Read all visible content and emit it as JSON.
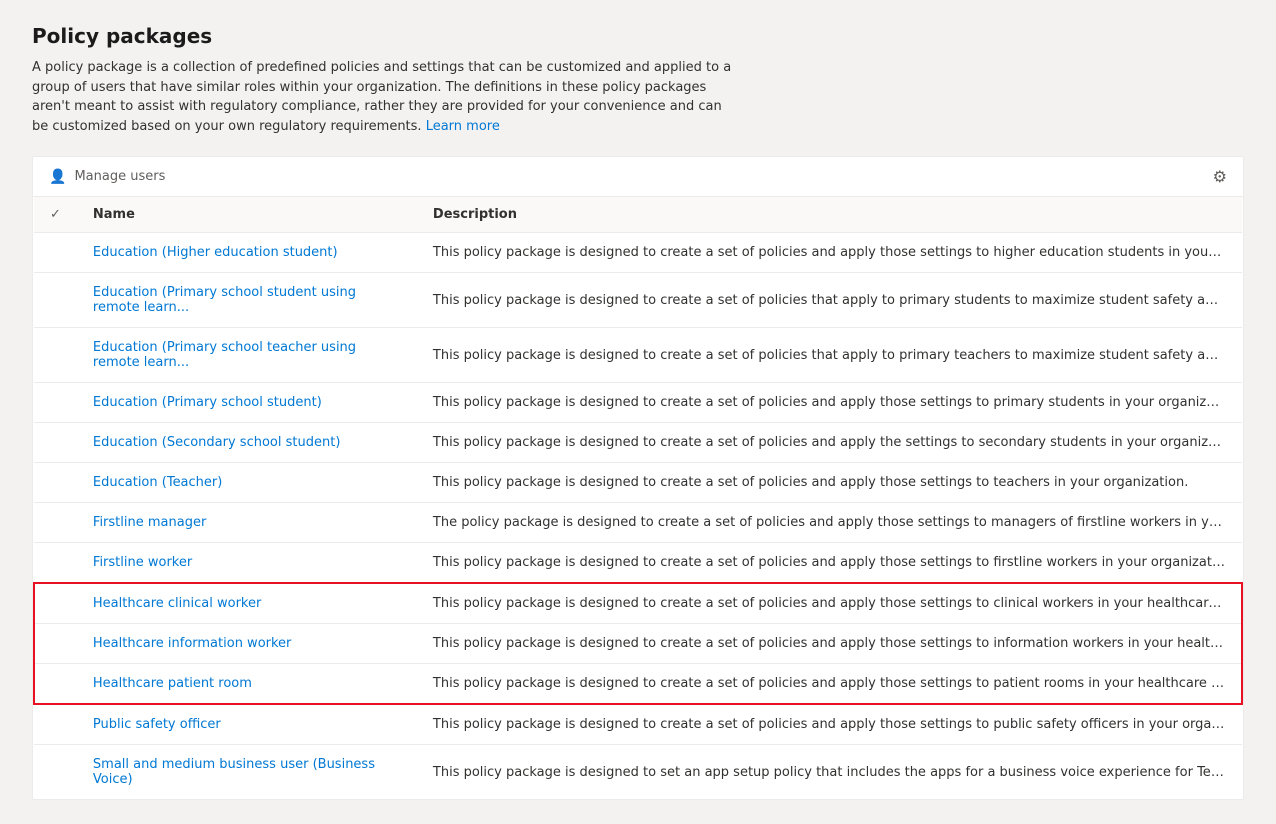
{
  "page": {
    "title": "Policy packages",
    "description": "A policy package is a collection of predefined policies and settings that can be customized and applied to a group of users that have similar roles within your organization. The definitions in these policy packages aren't meant to assist with regulatory compliance, rather they are provided for your convenience and can be customized based on your own regulatory requirements.",
    "learn_more_label": "Learn more"
  },
  "toolbar": {
    "manage_users_label": "Manage users",
    "settings_icon": "⚙"
  },
  "table": {
    "columns": [
      {
        "id": "check",
        "label": ""
      },
      {
        "id": "name",
        "label": "Name"
      },
      {
        "id": "description",
        "label": "Description"
      }
    ],
    "rows": [
      {
        "id": 1,
        "name": "Education (Higher education student)",
        "description": "This policy package is designed to create a set of policies and apply those settings to higher education students in your organization.",
        "highlighted": false
      },
      {
        "id": 2,
        "name": "Education (Primary school student using remote learn...",
        "description": "This policy package is designed to create a set of policies that apply to primary students to maximize student safety and collaboration wh",
        "highlighted": false
      },
      {
        "id": 3,
        "name": "Education (Primary school teacher using remote learn...",
        "description": "This policy package is designed to create a set of policies that apply to primary teachers to maximize student safety and collaboration wh",
        "highlighted": false
      },
      {
        "id": 4,
        "name": "Education (Primary school student)",
        "description": "This policy package is designed to create a set of policies and apply those settings to primary students in your organization.",
        "highlighted": false
      },
      {
        "id": 5,
        "name": "Education (Secondary school student)",
        "description": "This policy package is designed to create a set of policies and apply the settings to secondary students in your organization.",
        "highlighted": false
      },
      {
        "id": 6,
        "name": "Education (Teacher)",
        "description": "This policy package is designed to create a set of policies and apply those settings to teachers in your organization.",
        "highlighted": false
      },
      {
        "id": 7,
        "name": "Firstline manager",
        "description": "The policy package is designed to create a set of policies and apply those settings to managers of firstline workers in your organization.",
        "highlighted": false
      },
      {
        "id": 8,
        "name": "Firstline worker",
        "description": "This policy package is designed to create a set of policies and apply those settings to firstline workers in your organization.",
        "highlighted": false
      },
      {
        "id": 9,
        "name": "Healthcare clinical worker",
        "description": "This policy package is designed to create a set of policies and apply those settings to clinical workers in your healthcare organization.",
        "highlighted": true,
        "highlight_position": "top"
      },
      {
        "id": 10,
        "name": "Healthcare information worker",
        "description": "This policy package is designed to create a set of policies and apply those settings to information workers in your healthcare organizatio",
        "highlighted": true,
        "highlight_position": "middle"
      },
      {
        "id": 11,
        "name": "Healthcare patient room",
        "description": "This policy package is designed to create a set of policies and apply those settings to patient rooms in your healthcare organization.",
        "highlighted": true,
        "highlight_position": "bottom"
      },
      {
        "id": 12,
        "name": "Public safety officer",
        "description": "This policy package is designed to create a set of policies and apply those settings to public safety officers in your organization.",
        "highlighted": false
      },
      {
        "id": 13,
        "name": "Small and medium business user (Business Voice)",
        "description": "This policy package is designed to set an app setup policy that includes the apps for a business voice experience for Teams users",
        "highlighted": false
      }
    ]
  }
}
